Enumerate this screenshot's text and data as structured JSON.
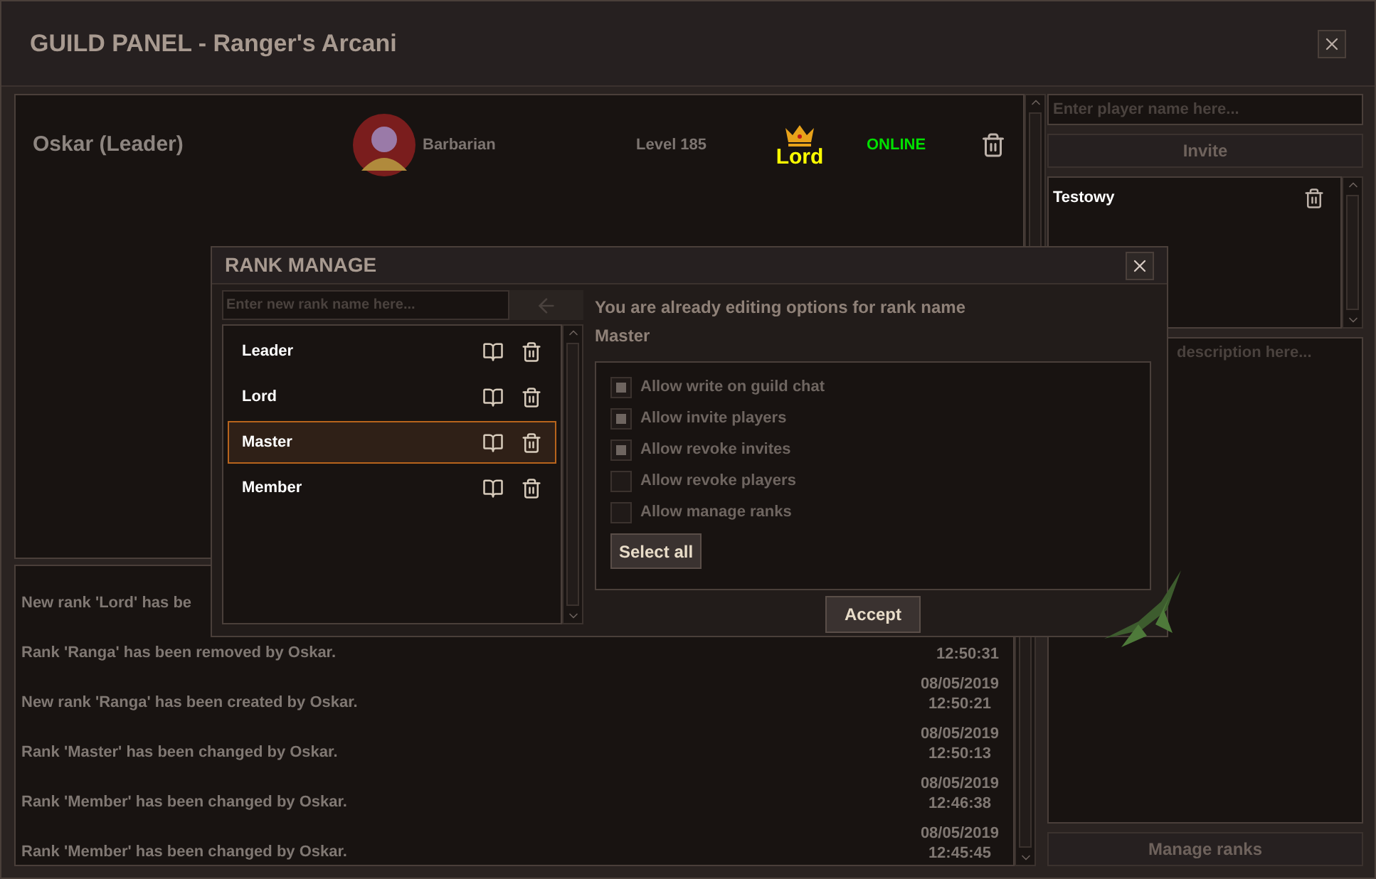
{
  "window": {
    "title": "GUILD PANEL - Ranger's Arcani"
  },
  "members": [
    {
      "name": "Oskar (Leader)",
      "class": "Barbarian",
      "level": "Level 185",
      "rank": "Lord",
      "status": "ONLINE"
    }
  ],
  "log": [
    {
      "message": "New rank 'Lord' has be"
    },
    {
      "message": "Rank 'Ranga' has been removed by Oskar.",
      "time": "12:50:31"
    },
    {
      "message": "New rank 'Ranga' has been created by Oskar.",
      "date": "08/05/2019",
      "time": "12:50:21"
    },
    {
      "message": "Rank 'Master' has been changed by Oskar.",
      "date": "08/05/2019",
      "time": "12:50:13"
    },
    {
      "message": "Rank 'Member' has been changed by Oskar.",
      "date": "08/05/2019",
      "time": "12:46:38"
    },
    {
      "message": "Rank 'Member' has been changed by Oskar.",
      "date": "08/05/2019",
      "time": "12:45:45"
    }
  ],
  "invite": {
    "placeholder": "Enter player name here...",
    "button": {
      "label": "Invite",
      "disabled": true
    }
  },
  "invites": [
    {
      "name": "Testowy"
    }
  ],
  "description": {
    "placeholder": "description here..."
  },
  "manage_button": {
    "label": "Manage ranks",
    "disabled": true
  },
  "rank_dialog": {
    "title": "RANK MANAGE",
    "placeholder": "Enter new rank name here...",
    "ranks": [
      {
        "name": "Leader",
        "selected": false
      },
      {
        "name": "Lord",
        "selected": false
      },
      {
        "name": "Master",
        "selected": true
      },
      {
        "name": "Member",
        "selected": false
      }
    ],
    "notice": "You are already editing options for rank name",
    "rank_name": "Master",
    "options": [
      {
        "label": "Allow write on guild chat",
        "checked": true
      },
      {
        "label": "Allow invite players",
        "checked": true
      },
      {
        "label": "Allow revoke invites",
        "checked": true
      },
      {
        "label": "Allow revoke players",
        "checked": false
      },
      {
        "label": "Allow manage ranks",
        "checked": false
      }
    ],
    "select_all": "Select all",
    "accept": "Accept"
  }
}
